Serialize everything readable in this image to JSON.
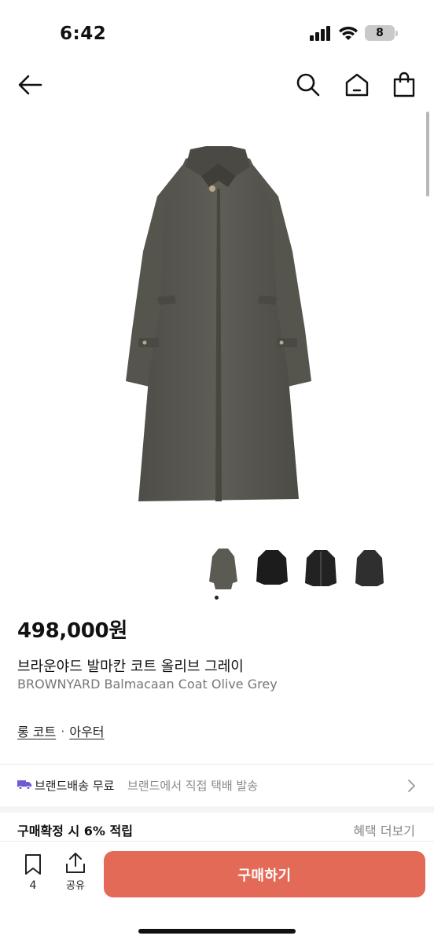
{
  "status_bar": {
    "time": "6:42",
    "battery": "8",
    "icons": [
      "signal-icon",
      "wifi-icon",
      "battery-icon"
    ]
  },
  "nav": {
    "icons": [
      "back-arrow-icon",
      "search-icon",
      "home-icon",
      "shopping-bag-icon"
    ]
  },
  "product": {
    "price": "498,000원",
    "name_ko": "브라운야드 발마칸 코트 올리브 그레이",
    "name_en": "BROWNYARD Balmacaan Coat Olive Grey",
    "category_1": "롱 코트",
    "category_sep": "·",
    "category_2": "아우터",
    "image_color": "#5b5a53",
    "thumbnail_colors": [
      "#5b5a53",
      "#1c1c1c",
      "#222222",
      "#2f2f2f"
    ],
    "selected_thumbnail": 1
  },
  "shipping": {
    "bold": "브랜드배송 무료",
    "sub": "브랜드에서 직접 택배 발송",
    "icon": "truck-icon",
    "icon_color": "#6b5bd6"
  },
  "reward": {
    "text": "구매확정 시 6% 적립",
    "more": "혜택 더보기"
  },
  "bottom_bar": {
    "bookmark_count": "4",
    "share_label": "공유",
    "buy_label": "구매하기",
    "buy_color": "#e46a58"
  }
}
